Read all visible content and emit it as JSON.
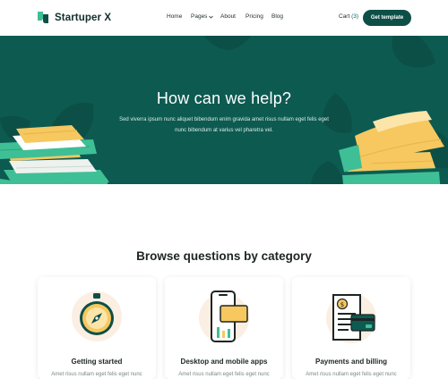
{
  "header": {
    "brand": "Startuper X",
    "nav": [
      {
        "label": "Home"
      },
      {
        "label": "Pages"
      },
      {
        "label": "About"
      },
      {
        "label": "Pricing"
      },
      {
        "label": "Blog"
      }
    ],
    "cart_label": "Cart",
    "cart_count": "(3)",
    "cta_label": "Get template"
  },
  "hero": {
    "title": "How can we help?",
    "subtitle": "Sed viverra ipsum nunc aliquet bibendum enim  gravida amet risus nullam eget felis eget nunc bibendum at varius vel pharetra vel."
  },
  "section": {
    "title": "Browse questions by category"
  },
  "categories": [
    {
      "title": "Getting started",
      "description": "Amet risus nullam eget felis eget nunc",
      "icon": "compass-icon"
    },
    {
      "title": "Desktop and mobile apps",
      "description": "Amet risus nullam eget felis eget nunc",
      "icon": "phone-app-icon"
    },
    {
      "title": "Payments and billing",
      "description": "Amet risus nullam eget felis eget nunc",
      "icon": "invoice-card-icon"
    }
  ],
  "colors": {
    "primary": "#0d5a51",
    "primary_dark": "#0d4f47",
    "accent_yellow": "#f6c85f",
    "accent_green": "#3fbf95",
    "peach": "#fbeee3"
  }
}
